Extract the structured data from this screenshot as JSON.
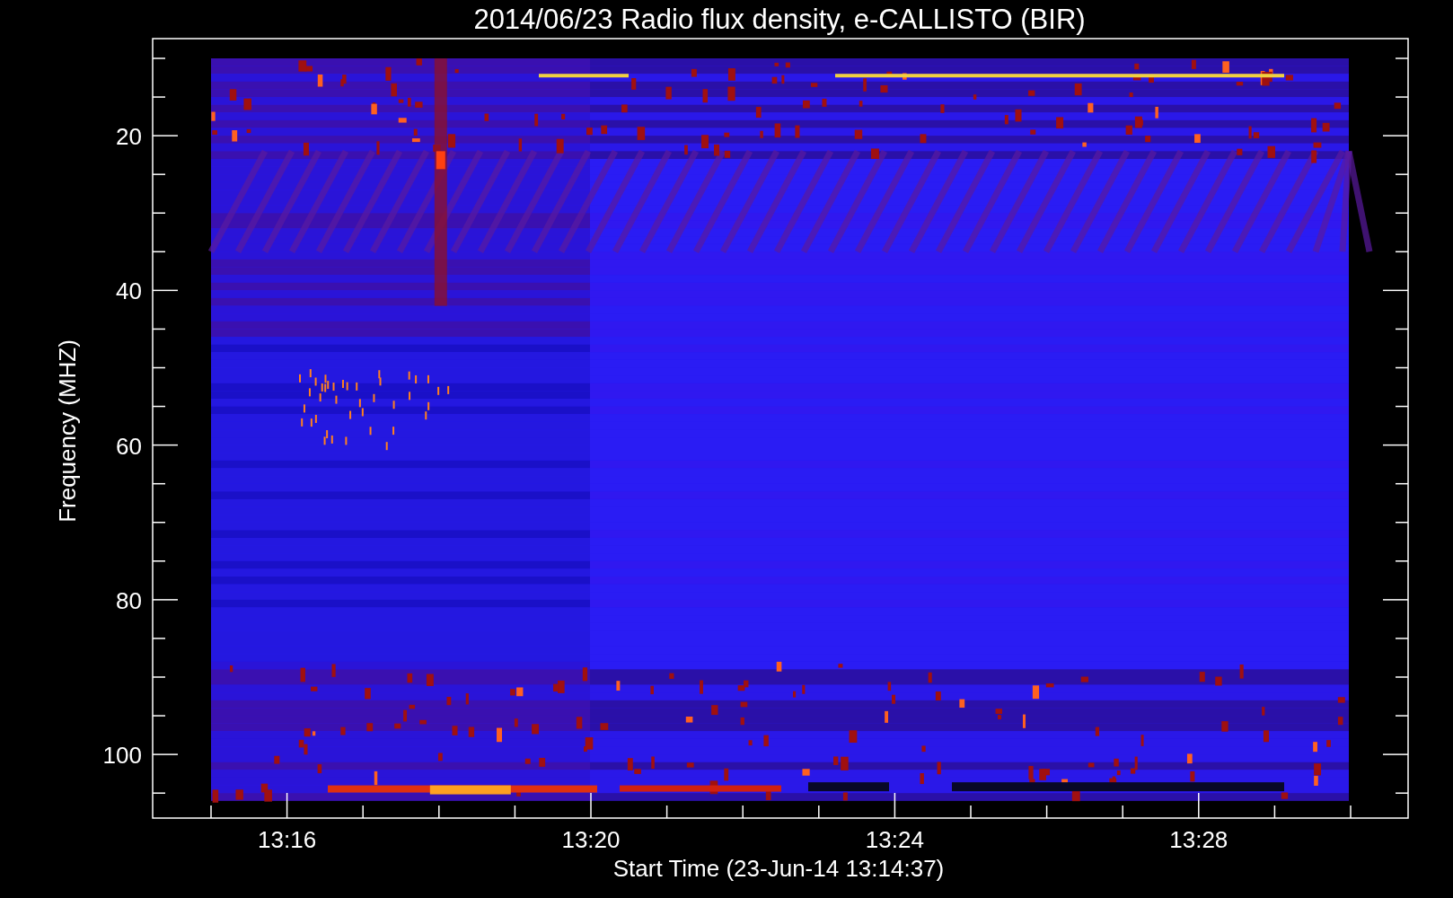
{
  "title": "2014/06/23  Radio flux density, e-CALLISTO (BIR)",
  "y_axis": {
    "label": "Frequency (MHZ)",
    "ticks": [
      "20",
      "40",
      "60",
      "80",
      "100"
    ]
  },
  "x_axis": {
    "label": "Start Time (23-Jun-14 13:14:37)",
    "ticks": [
      "13:16",
      "13:20",
      "13:24",
      "13:28"
    ]
  }
}
